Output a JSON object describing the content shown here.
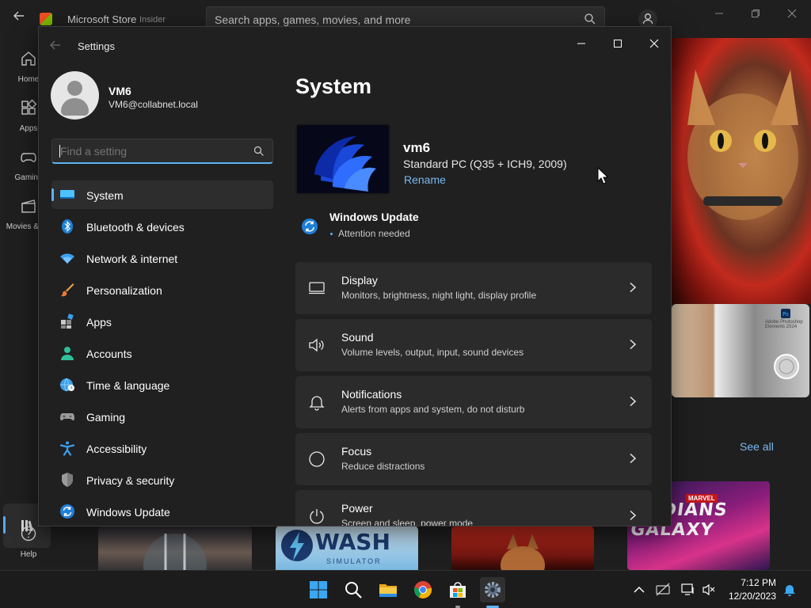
{
  "store": {
    "title": "Microsoft Store",
    "badge": "Insider",
    "search_placeholder": "Search apps, games, movies, and more",
    "nav": [
      {
        "label": "Home",
        "icon": "home-icon"
      },
      {
        "label": "Apps",
        "icon": "apps-icon"
      },
      {
        "label": "Gaming",
        "icon": "gaming-icon"
      },
      {
        "label": "Movies & TV",
        "icon": "movies-icon"
      },
      {
        "label": "Library",
        "icon": "library-icon"
      },
      {
        "label": "Help",
        "icon": "help-icon"
      }
    ],
    "see_all": "See all",
    "tiles": {
      "photoshop": "Adobe Photoshop Elements 2024",
      "wash_title": "WASH",
      "wash_sub": "SIMULATOR",
      "guardians_brand": "MARVEL",
      "guardians_title": "ARDIANS GALAXY"
    }
  },
  "settings": {
    "window_title": "Settings",
    "user": {
      "name": "VM6",
      "email": "VM6@collabnet.local"
    },
    "search": {
      "placeholder": "Find a setting"
    },
    "nav": [
      {
        "label": "System",
        "icon": "monitor-icon",
        "active": true
      },
      {
        "label": "Bluetooth & devices",
        "icon": "bluetooth-icon"
      },
      {
        "label": "Network & internet",
        "icon": "wifi-icon"
      },
      {
        "label": "Personalization",
        "icon": "brush-icon"
      },
      {
        "label": "Apps",
        "icon": "apps-icon"
      },
      {
        "label": "Accounts",
        "icon": "person-icon"
      },
      {
        "label": "Time & language",
        "icon": "globe-clock-icon"
      },
      {
        "label": "Gaming",
        "icon": "controller-icon"
      },
      {
        "label": "Accessibility",
        "icon": "accessibility-icon"
      },
      {
        "label": "Privacy & security",
        "icon": "shield-icon"
      },
      {
        "label": "Windows Update",
        "icon": "update-icon"
      }
    ],
    "main": {
      "title": "System",
      "device": {
        "name": "vm6",
        "model": "Standard PC (Q35 + ICH9, 2009)",
        "rename": "Rename"
      },
      "update": {
        "title": "Windows Update",
        "status": "Attention needed"
      },
      "cards": [
        {
          "title": "Display",
          "subtitle": "Monitors, brightness, night light, display profile",
          "icon": "display-icon"
        },
        {
          "title": "Sound",
          "subtitle": "Volume levels, output, input, sound devices",
          "icon": "speaker-icon"
        },
        {
          "title": "Notifications",
          "subtitle": "Alerts from apps and system, do not disturb",
          "icon": "bell-icon"
        },
        {
          "title": "Focus",
          "subtitle": "Reduce distractions",
          "icon": "focus-icon"
        },
        {
          "title": "Power",
          "subtitle": "Screen and sleep, power mode",
          "icon": "power-icon"
        }
      ]
    }
  },
  "taskbar": {
    "time": "7:12 PM",
    "date": "12/20/2023",
    "apps": [
      "windows-start-icon",
      "search-icon",
      "file-explorer-icon",
      "chrome-icon",
      "store-icon",
      "settings-icon"
    ]
  },
  "colors": {
    "accent": "#60b4f2",
    "link": "#7ab8f0",
    "window_bg": "#202020",
    "card_bg": "#2b2b2b"
  }
}
